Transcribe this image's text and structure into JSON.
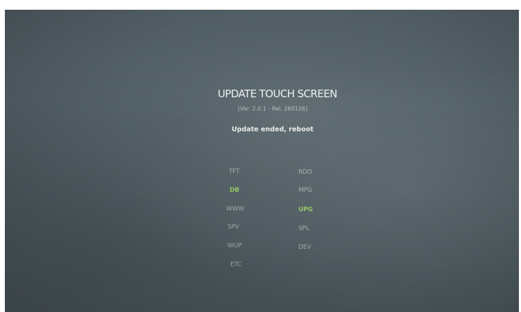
{
  "screen": {
    "title": "UPDATE TOUCH SCREEN",
    "version": "[Ver. 2.0.1 - Rel. 260126]",
    "status": "Update ended, reboot"
  },
  "modules": {
    "left": [
      {
        "label": "TFT",
        "status": "normal"
      },
      {
        "label": "DB",
        "status": "updated"
      },
      {
        "label": "WWW",
        "status": "normal"
      },
      {
        "label": "SPV",
        "status": "normal"
      },
      {
        "label": "WUP",
        "status": "normal"
      },
      {
        "label": "ETC",
        "status": "normal"
      }
    ],
    "right": [
      {
        "label": "RDO",
        "status": "normal"
      },
      {
        "label": "MPG",
        "status": "normal"
      },
      {
        "label": "UPG",
        "status": "updated"
      },
      {
        "label": "SPL",
        "status": "normal"
      },
      {
        "label": "DEV",
        "status": "normal"
      }
    ]
  },
  "colors": {
    "background": "#56636a",
    "text": "#e2e6e6",
    "updated": "#9bd36a"
  }
}
